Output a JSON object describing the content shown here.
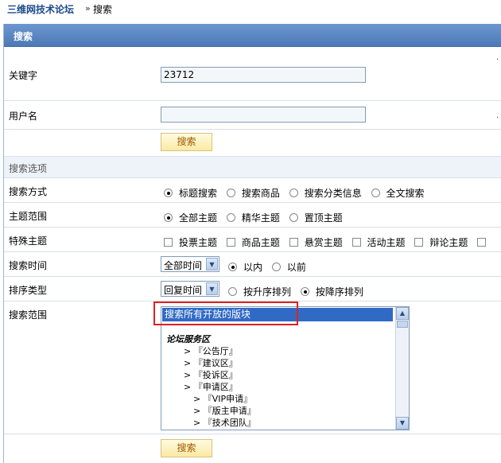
{
  "breadcrumb": {
    "site": "三维网技术论坛",
    "separator": "»",
    "current": "搜索"
  },
  "panel": {
    "title": "搜索"
  },
  "form": {
    "keyword": {
      "label": "关键字",
      "value": "23712"
    },
    "username": {
      "label": "用户名",
      "value": ""
    },
    "search_button": "搜索",
    "options_section": "搜索选项",
    "search_method": {
      "label": "搜索方式",
      "options": [
        "标题搜索",
        "搜索商品",
        "搜索分类信息",
        "全文搜索"
      ],
      "selected": "标题搜索"
    },
    "topic_scope": {
      "label": "主题范围",
      "options": [
        "全部主题",
        "精华主题",
        "置顶主题"
      ],
      "selected": "全部主题"
    },
    "special_topics": {
      "label": "特殊主题",
      "options": [
        "投票主题",
        "商品主题",
        "悬赏主题",
        "活动主题",
        "辩论主题"
      ]
    },
    "search_time": {
      "label": "搜索时间",
      "select_value": "全部时间",
      "options": [
        "以内",
        "以前"
      ],
      "selected": "以内"
    },
    "sort_type": {
      "label": "排序类型",
      "select_value": "回复时间",
      "options": [
        "按升序排列",
        "按降序排列"
      ],
      "selected": "按降序排列"
    },
    "search_range": {
      "label": "搜索范围",
      "selected_item": "搜索所有开放的版块",
      "category": "论坛服务区",
      "items": [
        {
          "text": "> 『公告厅』",
          "level": 1
        },
        {
          "text": "> 『建议区』",
          "level": 1
        },
        {
          "text": "> 『投诉区』",
          "level": 1
        },
        {
          "text": "> 『申请区』",
          "level": 1
        },
        {
          "text": "> 『VIP申请』",
          "level": 2
        },
        {
          "text": "> 『版主申请』",
          "level": 2
        },
        {
          "text": "> 『技术团队』",
          "level": 2
        }
      ]
    },
    "submit_button": "搜索"
  },
  "colors": {
    "header_bg": "#5a86c3",
    "site_link": "#1a4a8a",
    "button_bg": "#fbe9a3",
    "highlight": "#e02020",
    "list_selected": "#316ac5"
  }
}
